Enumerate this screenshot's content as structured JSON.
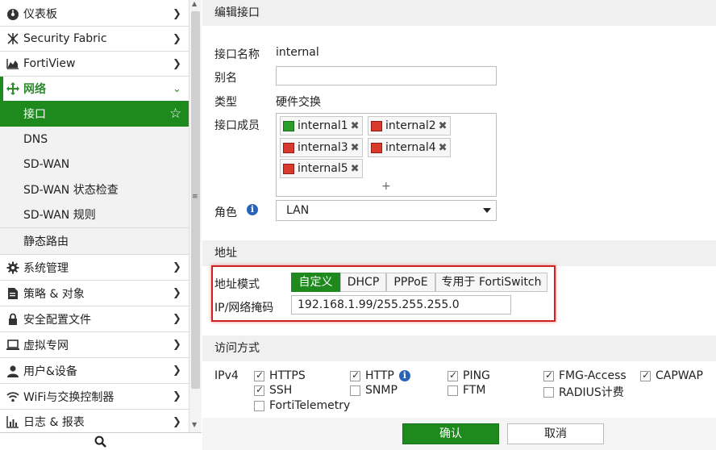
{
  "sidebar": {
    "items": [
      {
        "label": "仪表板",
        "icon": "dashboard-icon"
      },
      {
        "label": "Security Fabric",
        "icon": "fabric-icon"
      },
      {
        "label": "FortiView",
        "icon": "chart-icon"
      },
      {
        "label": "网络",
        "icon": "network-move-icon"
      },
      {
        "label": "接口"
      },
      {
        "label": "DNS"
      },
      {
        "label": "SD-WAN"
      },
      {
        "label": "SD-WAN 状态检查"
      },
      {
        "label": "SD-WAN 规则"
      },
      {
        "label": "静态路由"
      },
      {
        "label": "系统管理",
        "icon": "gear-icon"
      },
      {
        "label": "策略 & 对象",
        "icon": "policy-icon"
      },
      {
        "label": "安全配置文件",
        "icon": "lock-icon"
      },
      {
        "label": "虚拟专网",
        "icon": "monitor-icon"
      },
      {
        "label": "用户&设备",
        "icon": "user-icon"
      },
      {
        "label": "WiFi与交换控制器",
        "icon": "wifi-icon"
      },
      {
        "label": "日志 & 报表",
        "icon": "bar-chart-icon"
      }
    ]
  },
  "editor": {
    "title": "编辑接口",
    "name_label": "接口名称",
    "name_value": "internal",
    "alias_label": "别名",
    "alias_value": "",
    "type_label": "类型",
    "type_value": "硬件交换",
    "members_label": "接口成员",
    "members": [
      {
        "name": "internal1",
        "status": "up"
      },
      {
        "name": "internal2",
        "status": "down"
      },
      {
        "name": "internal3",
        "status": "down"
      },
      {
        "name": "internal4",
        "status": "down"
      },
      {
        "name": "internal5",
        "status": "down"
      }
    ],
    "members_add": "+",
    "role_label": "角色",
    "role_value": "LAN"
  },
  "address": {
    "title": "地址",
    "mode_label": "地址模式",
    "modes": [
      "自定义",
      "DHCP",
      "PPPoE",
      "专用于 FortiSwitch"
    ],
    "selected_mode": "自定义",
    "ip_label": "IP/网络掩码",
    "ip_value": "192.168.1.99/255.255.255.0"
  },
  "access": {
    "title": "访问方式",
    "ipv4_label": "IPv4",
    "options": [
      {
        "label": "HTTPS",
        "checked": true
      },
      {
        "label": "HTTP",
        "checked": true
      },
      {
        "label": "PING",
        "checked": true
      },
      {
        "label": "FMG-Access",
        "checked": true
      },
      {
        "label": "CAPWAP",
        "checked": true
      },
      {
        "label": "SSH",
        "checked": true
      },
      {
        "label": "SNMP",
        "checked": false
      },
      {
        "label": "FTM",
        "checked": false
      },
      {
        "label": "RADIUS计费",
        "checked": false
      },
      {
        "label": "FortiTelemetry",
        "checked": false
      }
    ]
  },
  "footer": {
    "ok_label": "确认",
    "cancel_label": "取消"
  },
  "colors": {
    "accent": "#1e8a1e",
    "highlight_border": "#d0201f",
    "link_up": "#2b9d2b",
    "link_down": "#d93a2e"
  }
}
